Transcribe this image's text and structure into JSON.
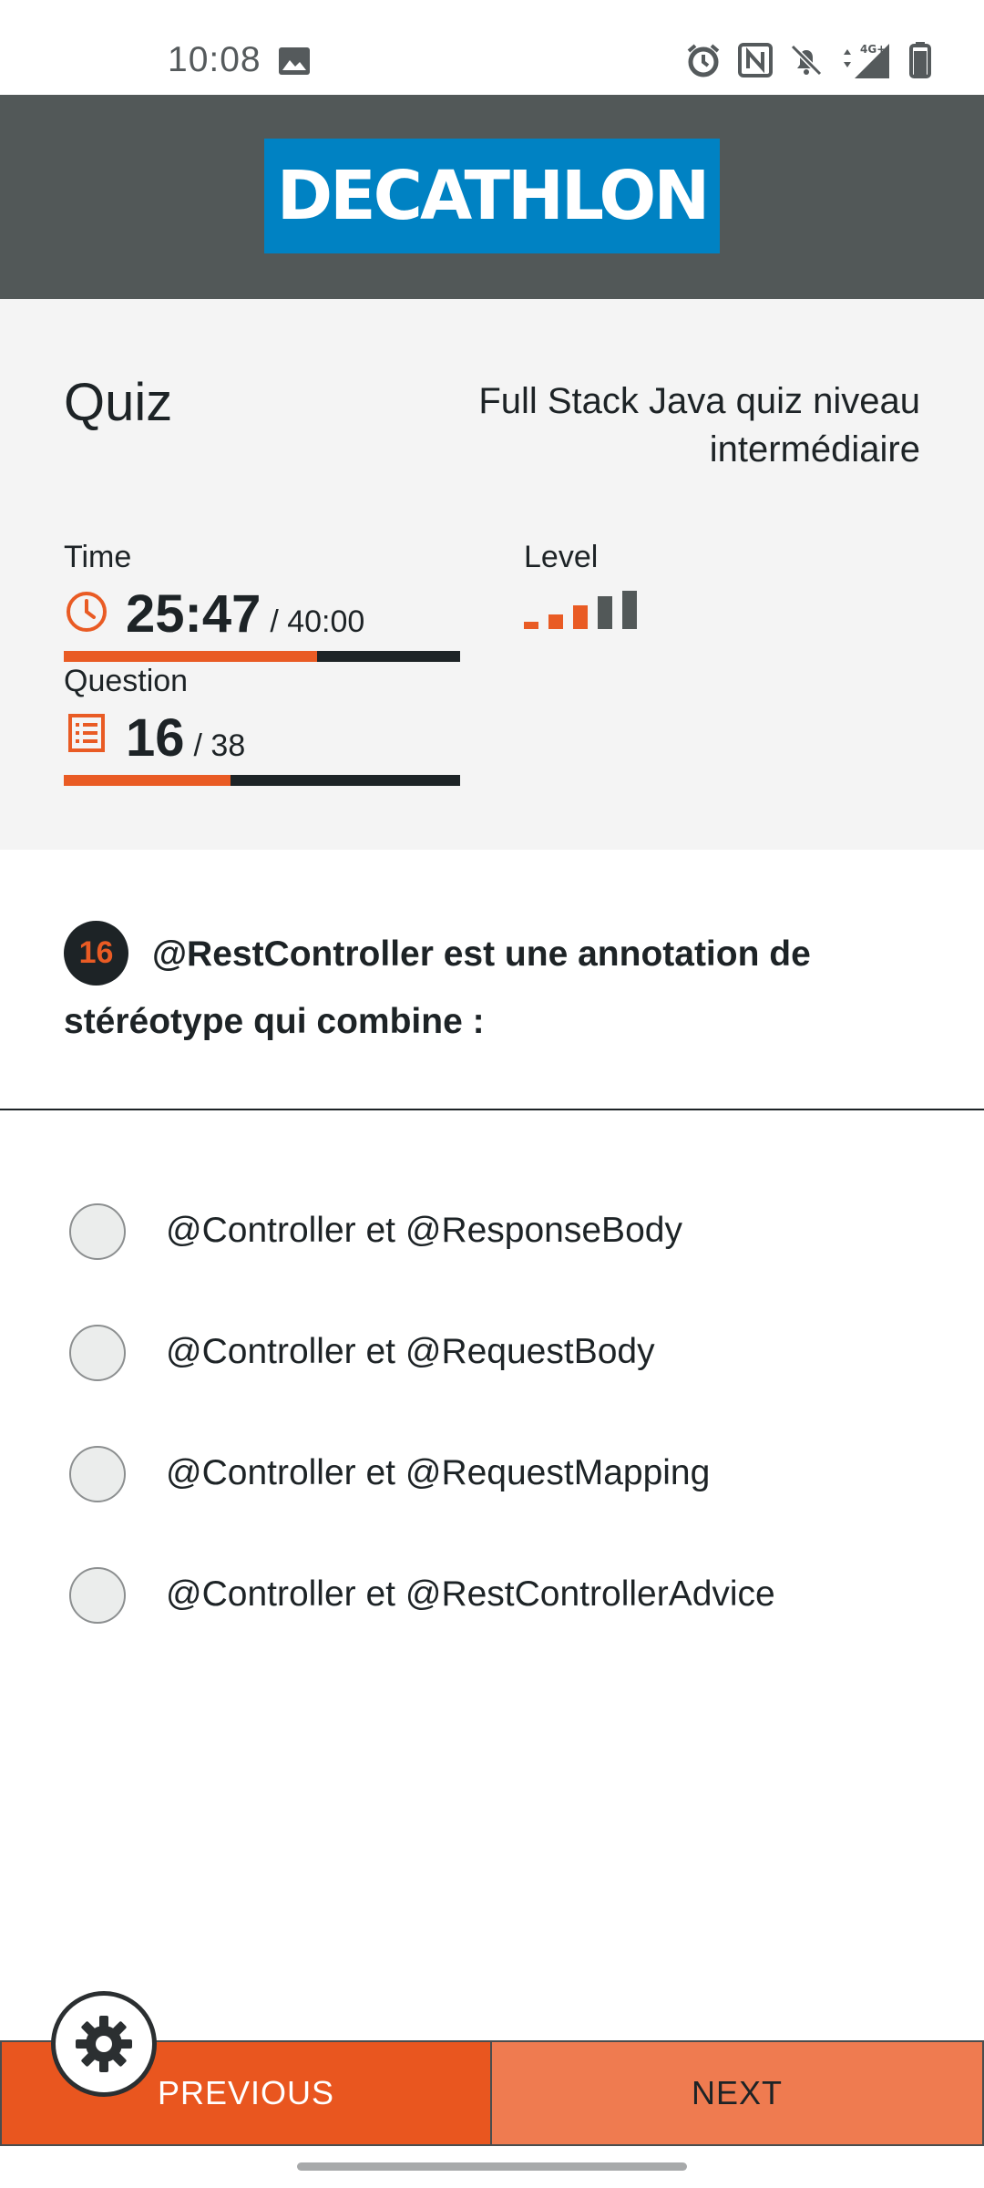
{
  "status_bar": {
    "time": "10:08",
    "network": "4G+",
    "icons": [
      "image-icon",
      "alarm-icon",
      "nfc-icon",
      "bell-off-icon",
      "signal-icon",
      "battery-icon"
    ]
  },
  "brand": {
    "logo_text": "DECATHLON",
    "logo_color": "#0082c3",
    "header_color": "#525858"
  },
  "quiz": {
    "title": "Quiz",
    "name": "Full Stack Java quiz niveau intermédiaire",
    "time_label": "Time",
    "time_elapsed": "25:47",
    "time_total": "/ 40:00",
    "time_progress_percent": 64,
    "question_label": "Question",
    "question_current": "16",
    "question_total": "/ 38",
    "question_progress_percent": 42,
    "level_label": "Level",
    "level_value": 3,
    "level_max": 5
  },
  "question": {
    "number": "16",
    "text": "@RestController est une annotation de stéréotype qui combine :"
  },
  "answers": [
    {
      "label": "@Controller et @ResponseBody",
      "selected": false
    },
    {
      "label": "@Controller et @RequestBody",
      "selected": false
    },
    {
      "label": "@Controller et @RequestMapping",
      "selected": false
    },
    {
      "label": "@Controller et @RestControllerAdvice",
      "selected": false
    }
  ],
  "navigation": {
    "previous_label": "PREVIOUS",
    "next_label": "NEXT"
  },
  "colors": {
    "accent": "#e95b24",
    "dark": "#1d2326",
    "level_inactive": "#525858"
  }
}
